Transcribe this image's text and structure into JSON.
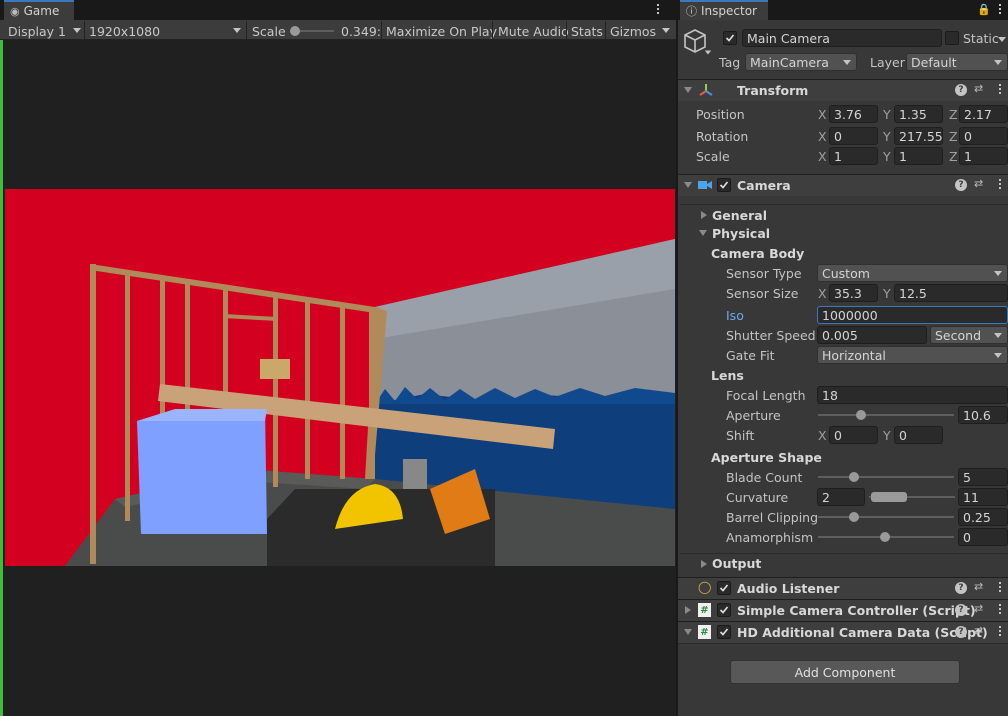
{
  "game": {
    "tab_label": "Game",
    "display": "Display 1",
    "resolution": "1920x1080",
    "scale_label": "Scale",
    "scale_value": "0.349:",
    "maximize": "Maximize On Play",
    "mute": "Mute Audio",
    "stats": "Stats",
    "gizmos": "Gizmos"
  },
  "inspector": {
    "tab_label": "Inspector",
    "object_name": "Main Camera",
    "static_label": "Static",
    "tag_label": "Tag",
    "tag_value": "MainCamera",
    "layer_label": "Layer",
    "layer_value": "Default",
    "transform": {
      "title": "Transform",
      "position_label": "Position",
      "rotation_label": "Rotation",
      "scale_label": "Scale",
      "position": {
        "x": "3.76",
        "y": "1.35",
        "z": "2.17"
      },
      "rotation": {
        "x": "0",
        "y": "217.55",
        "z": "0"
      },
      "scale": {
        "x": "1",
        "y": "1",
        "z": "1"
      }
    },
    "camera": {
      "title": "Camera",
      "general": "General",
      "physical": "Physical",
      "camera_body": "Camera Body",
      "sensor_type_label": "Sensor Type",
      "sensor_type_value": "Custom",
      "sensor_size_label": "Sensor Size",
      "sensor_x": "35.3",
      "sensor_y": "12.5",
      "iso_label": "Iso",
      "iso_value": "1000000",
      "shutter_label": "Shutter Speed",
      "shutter_value": "0.005",
      "shutter_unit": "Second",
      "gatefit_label": "Gate Fit",
      "gatefit_value": "Horizontal",
      "lens": "Lens",
      "focal_label": "Focal Length",
      "focal_value": "18",
      "aperture_label": "Aperture",
      "aperture_value": "10.6",
      "shift_label": "Shift",
      "shift_x": "0",
      "shift_y": "0",
      "aperture_shape": "Aperture Shape",
      "blade_label": "Blade Count",
      "blade_value": "5",
      "curvature_label": "Curvature",
      "curvature_min": "2",
      "curvature_max": "11",
      "barrel_label": "Barrel Clipping",
      "barrel_value": "0.25",
      "anamorph_label": "Anamorphism",
      "anamorph_value": "0",
      "output": "Output"
    },
    "audio_listener": "Audio Listener",
    "simple_camera": "Simple Camera Controller (Script)",
    "hd_camera": "HD Additional Camera Data (Script)",
    "add_component": "Add Component"
  },
  "axes": {
    "x": "X",
    "y": "Y",
    "z": "Z"
  }
}
